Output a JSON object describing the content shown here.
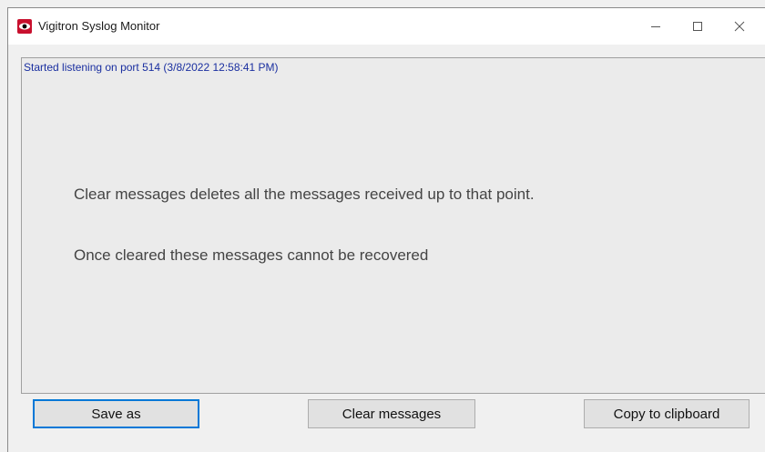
{
  "window": {
    "title": "Vigitron Syslog Monitor",
    "icon": "eye-icon",
    "controls": [
      "minimize-icon",
      "maximize-icon",
      "close-icon"
    ]
  },
  "log": {
    "lines": [
      "Started listening on port 514 (3/8/2022 12:58:41 PM)"
    ]
  },
  "info": {
    "line1": "Clear messages deletes all the messages received up to that point.",
    "line2": "Once cleared these messages cannot be recovered"
  },
  "buttons": {
    "save_as": "Save as",
    "clear_messages": "Clear messages",
    "copy_to_clipboard": "Copy to clipboard"
  },
  "colors": {
    "log_text": "#1a2fa0",
    "default_button_border": "#0078d7",
    "icon_red": "#c8102e"
  }
}
